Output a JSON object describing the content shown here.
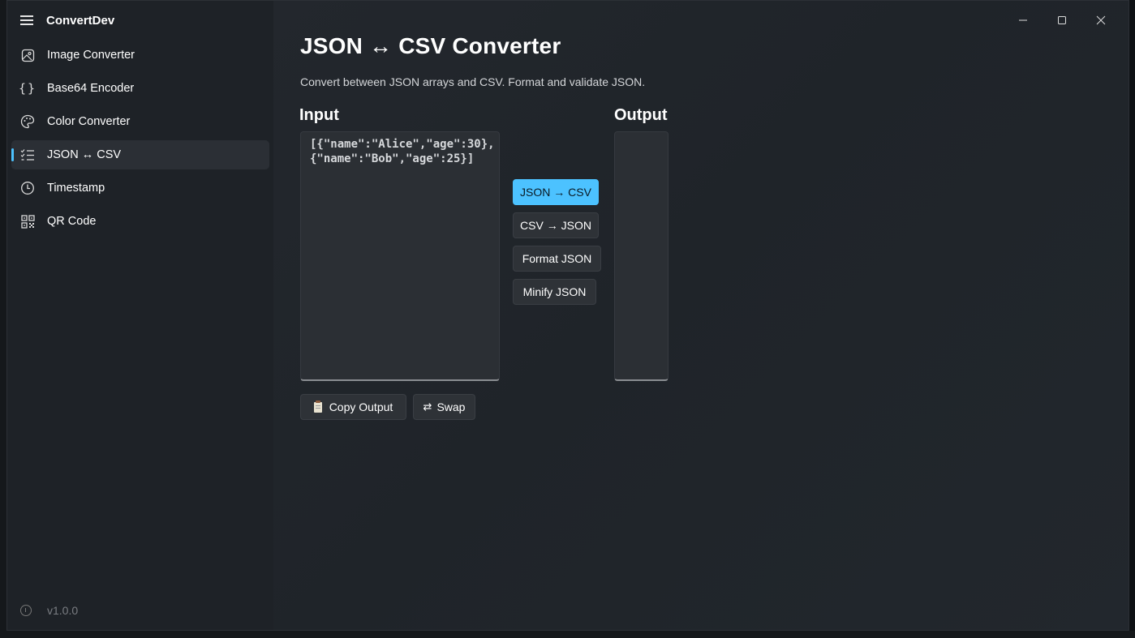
{
  "app": {
    "title": "ConvertDev",
    "version": "v1.0.0"
  },
  "sidebar": {
    "items": [
      {
        "label": "Image Converter",
        "icon": "image-icon",
        "active": false
      },
      {
        "label": "Base64 Encoder",
        "icon": "braces-icon",
        "active": false
      },
      {
        "label": "Color Converter",
        "icon": "palette-icon",
        "active": false
      },
      {
        "label": "JSON ↔ CSV",
        "icon": "list-check-icon",
        "active": true
      },
      {
        "label": "Timestamp",
        "icon": "clock-icon",
        "active": false
      },
      {
        "label": "QR Code",
        "icon": "qr-code-icon",
        "active": false
      }
    ]
  },
  "page": {
    "title": "JSON ↔ CSV Converter",
    "description": "Convert between JSON arrays and CSV. Format and validate JSON.",
    "input_label": "Input",
    "output_label": "Output",
    "input_value": "[{\"name\":\"Alice\",\"age\":30},\n{\"name\":\"Bob\",\"age\":25}]",
    "output_value": ""
  },
  "actions": {
    "json_to_csv": "JSON → CSV",
    "csv_to_json": "CSV → JSON",
    "format_json": "Format JSON",
    "minify_json": "Minify JSON",
    "copy_output": "Copy Output",
    "swap": "Swap",
    "swap_glyph": "⇄"
  },
  "colors": {
    "accent": "#4cc2ff",
    "sidebar_bg": "#1e2227",
    "content_bg": "#22272d"
  }
}
